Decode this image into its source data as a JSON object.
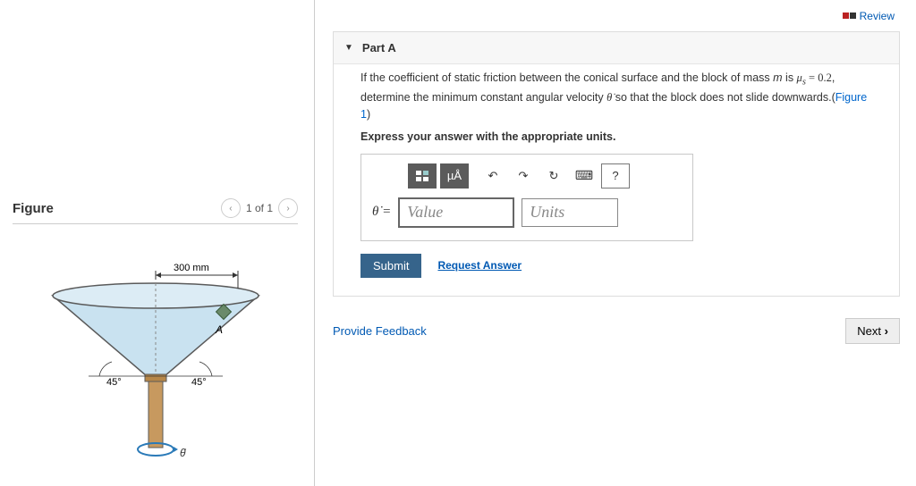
{
  "toplinks": {
    "review": "Review"
  },
  "figure": {
    "title": "Figure",
    "pager": "1 of 1",
    "dim_label": "300 mm",
    "angle_left": "45°",
    "angle_right": "45°",
    "point_label": "A",
    "theta_label": "θ̇"
  },
  "part": {
    "label": "Part A",
    "prompt_pre": "If the coefficient of static friction between the conical surface and the block of mass ",
    "prompt_m": "m",
    "prompt_mid": " is ",
    "prompt_mu": "μs = 0.2",
    "prompt_post": ", determine the minimum constant angular velocity ",
    "prompt_thetadot": "θ̇",
    "prompt_tail": " so that the block does not slide downwards.(",
    "figlink": "Figure 1",
    "prompt_end": ")",
    "instruction": "Express your answer with the appropriate units.",
    "lhs": "θ̇ =",
    "value_placeholder": "Value",
    "units_placeholder": "Units",
    "toolbar": {
      "template": "template-icon",
      "units_btn": "µÅ",
      "undo": "↶",
      "redo": "↷",
      "reset": "↻",
      "keyboard": "⌨",
      "help": "?"
    },
    "submit": "Submit",
    "request": "Request Answer"
  },
  "feedback": "Provide Feedback",
  "next": "Next"
}
